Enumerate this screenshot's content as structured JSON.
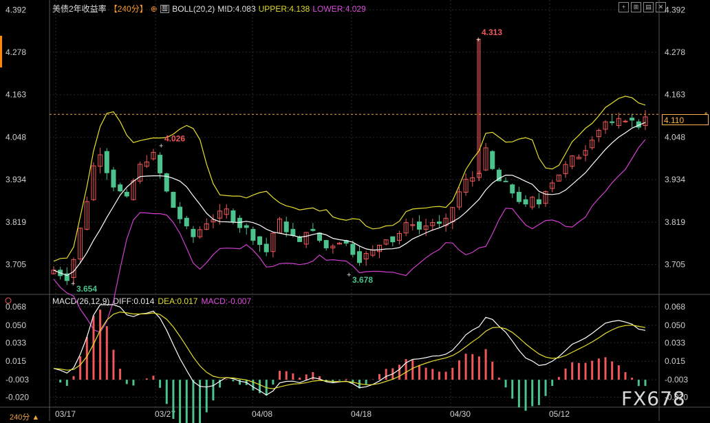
{
  "header": {
    "symbol": "美债2年收益率",
    "period_tag": "【240分】",
    "boll_label": "BOLL(20,2)",
    "mid": "MID:4.083",
    "upper": "UPPER:4.138",
    "lower": "LOWER:4.029"
  },
  "macd_header": {
    "label": "MACD(26,12,9)",
    "diff": "DIFF:0.014",
    "dea": "DEA:0.017",
    "macd": "MACD:-0.007"
  },
  "current_price": "4.110",
  "period_button": "240分",
  "watermark": "FX678",
  "colors": {
    "up": "#f0585a",
    "down": "#4cc28c",
    "upper": "#e6df2c",
    "lower": "#d23fd2",
    "mid": "#ffffff",
    "grid": "#2b2b2b"
  },
  "chart_data": [
    {
      "type": "candlestick",
      "y_ticks": [
        "4.392",
        "4.278",
        "4.163",
        "4.048",
        "3.934",
        "3.819",
        "3.705"
      ],
      "ylim": [
        3.63,
        4.4
      ],
      "x_ticks": [
        "03/17",
        "03/27",
        "04/08",
        "04/18",
        "04/30",
        "05/12"
      ],
      "annotations": [
        {
          "label": "4.313",
          "value": 4.313,
          "kind": "high"
        },
        {
          "label": "4.026",
          "value": 4.026,
          "kind": "high"
        },
        {
          "label": "3.654",
          "value": 3.654,
          "kind": "low"
        },
        {
          "label": "3.678",
          "value": 3.678,
          "kind": "low"
        }
      ],
      "series": [
        {
          "name": "UPPER",
          "value": 4.138
        },
        {
          "name": "MID",
          "value": 4.083
        },
        {
          "name": "LOWER",
          "value": 4.029
        }
      ],
      "close_path": [
        3.69,
        3.68,
        3.67,
        3.72,
        3.8,
        3.88,
        3.97,
        4.01,
        3.96,
        3.92,
        3.9,
        3.88,
        3.93,
        3.97,
        3.99,
        4.0,
        3.95,
        3.9,
        3.86,
        3.83,
        3.8,
        3.78,
        3.8,
        3.82,
        3.83,
        3.84,
        3.85,
        3.83,
        3.81,
        3.8,
        3.78,
        3.76,
        3.74,
        3.79,
        3.82,
        3.8,
        3.78,
        3.76,
        3.8,
        3.79,
        3.77,
        3.75,
        3.76,
        3.77,
        3.76,
        3.74,
        3.72,
        3.73,
        3.74,
        3.76,
        3.78,
        3.77,
        3.79,
        3.81,
        3.82,
        3.8,
        3.81,
        3.82,
        3.81,
        3.82,
        3.86,
        3.9,
        3.93,
        3.94,
        3.96,
        4.01,
        3.96,
        3.93,
        3.92,
        3.9,
        3.88,
        3.86,
        3.88,
        3.87,
        3.91,
        3.93,
        3.95,
        3.97,
        3.99,
        4.0,
        4.02,
        4.05,
        4.07,
        4.09,
        4.08,
        4.09,
        4.1,
        4.09,
        4.08,
        4.11
      ]
    },
    {
      "type": "macd",
      "y_ticks": [
        "0.068",
        "0.050",
        "0.033",
        "0.015",
        "-0.003",
        "-0.020"
      ],
      "ylim": [
        -0.025,
        0.072
      ],
      "series": [
        {
          "name": "DIFF",
          "value": 0.014
        },
        {
          "name": "DEA",
          "value": 0.017
        },
        {
          "name": "MACD",
          "value": -0.007
        }
      ]
    }
  ]
}
